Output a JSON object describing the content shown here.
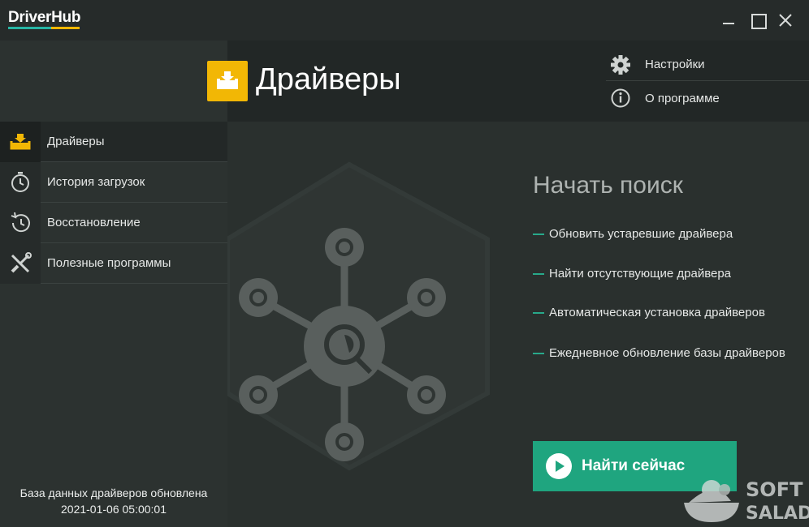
{
  "app": {
    "logo_text": "DriverHub"
  },
  "header": {
    "title": "Драйверы",
    "menu": {
      "settings": "Настройки",
      "about": "О программе"
    }
  },
  "sidebar": {
    "items": [
      {
        "label": "Драйверы",
        "icon": "drivers-tray-icon",
        "active": true
      },
      {
        "label": "История загрузок",
        "icon": "clock-icon"
      },
      {
        "label": "Восстановление",
        "icon": "history-restore-icon"
      },
      {
        "label": "Полезные программы",
        "icon": "tools-icon"
      }
    ],
    "db_status_line1": "База данных драйверов обновлена",
    "db_status_line2": "2021-01-06 05:00:01"
  },
  "main": {
    "search_title": "Начать поиск",
    "features": [
      "Обновить устаревшие драйвера",
      "Найти отсутствующие драйвера",
      "Автоматическая установка драйверов",
      "Ежедневное обновление базы драйверов"
    ],
    "find_button": "Найти сейчас"
  },
  "watermark": {
    "line1": "SOFT",
    "line2": "SALAD"
  },
  "colors": {
    "accent_yellow": "#f2b705",
    "accent_green": "#1fa57f",
    "logo_teal": "#27b5a4"
  }
}
